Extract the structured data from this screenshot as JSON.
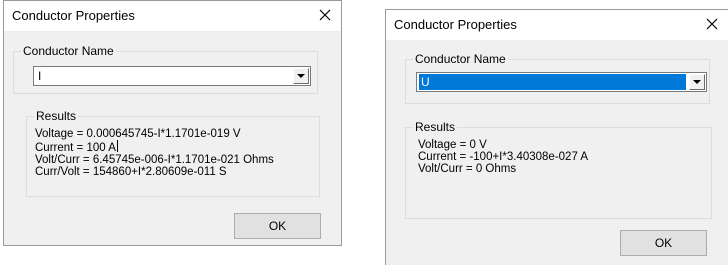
{
  "dialogs": [
    {
      "title": "Conductor Properties",
      "close_symbol": "✕",
      "name_group_label": "Conductor Name",
      "conductor_name": "I",
      "results_group_label": "Results",
      "results": [
        "Voltage = 0.000645745-I*1.1701e-019 V",
        "Current = 100 A",
        "Volt/Curr = 6.45745e-006-I*1.1701e-021 Ohms",
        "Curr/Volt = 154860+I*2.80609e-011 S"
      ],
      "ok_label": "OK"
    },
    {
      "title": "Conductor Properties",
      "close_symbol": "✕",
      "name_group_label": "Conductor Name",
      "conductor_name": "U",
      "results_group_label": "Results",
      "results": [
        "Voltage = 0 V",
        "Current = -100+I*3.40308e-027 A",
        "Volt/Curr = 0 Ohms"
      ],
      "ok_label": "OK"
    }
  ],
  "icons": {
    "close": "close-icon",
    "dropdown": "chevron-down-icon"
  },
  "colors": {
    "selection": "#0078d7",
    "client_bg": "#f0f0f0",
    "button_bg": "#e1e1e1"
  }
}
